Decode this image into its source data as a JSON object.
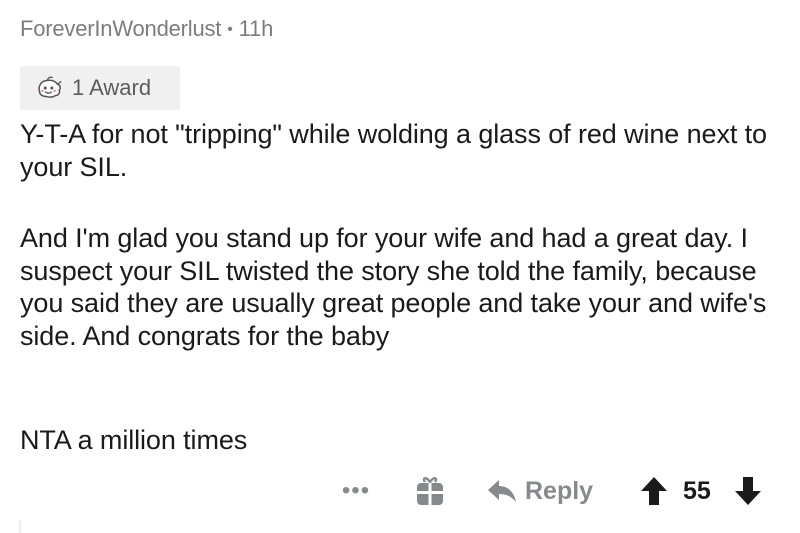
{
  "comment": {
    "author": "ForeverInWonderlust",
    "separator": "•",
    "age": "11h",
    "award": {
      "icon": "wholesome-seal-icon",
      "label": "1 Award"
    },
    "paragraphs": [
      "Y-T-A for not \"tripping\" while wolding a glass of red wine next to your SIL.",
      "And I'm glad you stand up for your wife and had a great day. I suspect your SIL twisted the story she told the family, because you said they are usually great people and take your and wife's side. And congrats for the baby",
      "NTA a million times"
    ],
    "actions": {
      "more_label": "•••",
      "gift_icon": "gift-icon",
      "reply_label": "Reply",
      "score": "55"
    }
  },
  "colors": {
    "meta_text": "#7c7c7c",
    "body_text": "#1a1a1b",
    "action_gray": "#878a8c",
    "award_bg": "#f0f0f0"
  }
}
